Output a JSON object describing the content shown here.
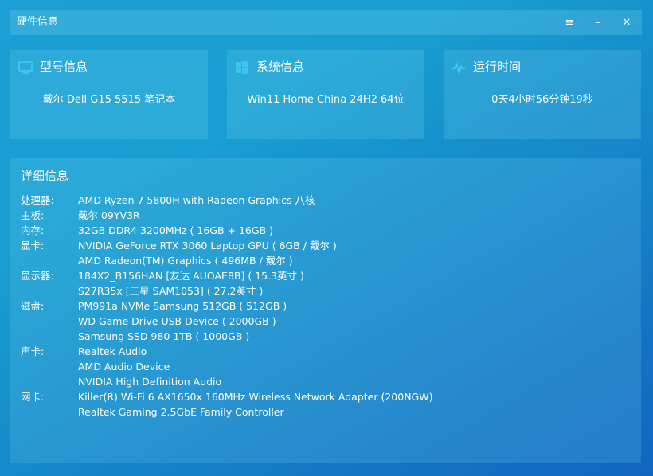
{
  "window": {
    "title": "硬件信息",
    "controls": {
      "menu": "≡",
      "minimize": "–",
      "close": "✕"
    }
  },
  "cards": [
    {
      "icon": "monitor-icon",
      "title": "型号信息",
      "value": "戴尔 Dell G15 5515 笔记本"
    },
    {
      "icon": "windows-logo-icon",
      "title": "系统信息",
      "value": "Win11 Home China 24H2 64位"
    },
    {
      "icon": "pulse-icon",
      "title": "运行时间",
      "value": "0天4小时56分钟19秒"
    }
  ],
  "details": {
    "title": "详细信息",
    "groups": [
      {
        "label": "处理器:",
        "values": [
          "AMD Ryzen 7 5800H with Radeon Graphics 八核"
        ]
      },
      {
        "label": "主板:",
        "values": [
          "戴尔 09YV3R"
        ]
      },
      {
        "label": "内存:",
        "values": [
          "32GB DDR4 3200MHz ( 16GB + 16GB )"
        ]
      },
      {
        "label": "显卡:",
        "values": [
          "NVIDIA GeForce RTX 3060 Laptop GPU ( 6GB / 戴尔 )",
          "AMD Radeon(TM) Graphics ( 496MB / 戴尔 )"
        ]
      },
      {
        "label": "显示器:",
        "values": [
          "184X2_B156HAN [友达 AUOAE8B] ( 15.3英寸 )",
          "S27R35x [三星 SAM1053] ( 27.2英寸 )"
        ]
      },
      {
        "label": "磁盘:",
        "values": [
          "PM991a NVMe Samsung 512GB ( 512GB )",
          "WD Game Drive USB Device ( 2000GB )",
          "Samsung SSD 980 1TB ( 1000GB )"
        ]
      },
      {
        "label": "声卡:",
        "values": [
          "Realtek Audio",
          "AMD Audio Device",
          "NVIDIA High Definition Audio"
        ]
      },
      {
        "label": "网卡:",
        "values": [
          "Killer(R) Wi-Fi 6 AX1650x 160MHz Wireless Network Adapter (200NGW)",
          "Realtek Gaming 2.5GbE Family Controller"
        ]
      }
    ]
  }
}
